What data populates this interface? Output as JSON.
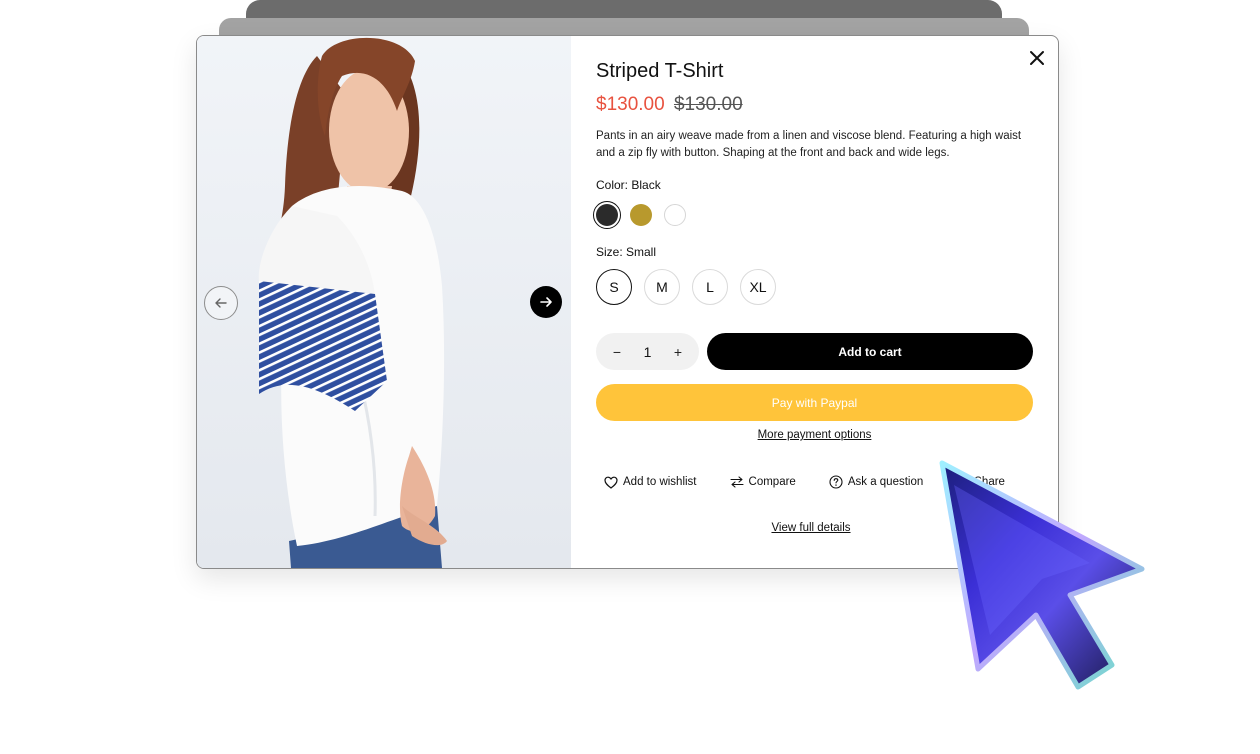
{
  "product": {
    "title": "Striped T-Shirt",
    "price_sale": "$130.00",
    "price_original": "$130.00",
    "description": "Pants in an airy weave made from a linen and viscose blend. Featuring a high waist and a zip fly with button. Shaping at the front and back and wide legs.",
    "color_label": "Color: Black",
    "colors": [
      {
        "name": "Black",
        "hex": "#2b2b2b",
        "selected": true
      },
      {
        "name": "Mustard",
        "hex": "#b8992d",
        "selected": false
      },
      {
        "name": "White",
        "hex": "#ffffff",
        "selected": false
      }
    ],
    "size_label": "Size: Small",
    "sizes": [
      "S",
      "M",
      "L",
      "XL"
    ],
    "selected_size": "S",
    "quantity": "1"
  },
  "buttons": {
    "qty_minus": "−",
    "qty_plus": "+",
    "add_to_cart": "Add to cart",
    "paypal": "Pay with Paypal",
    "more_payment": "More payment options",
    "view_full_details": "View full details"
  },
  "actions": [
    {
      "label": "Add to wishlist",
      "icon": "heart-icon"
    },
    {
      "label": "Compare",
      "icon": "compare-arrows-icon"
    },
    {
      "label": "Ask a question",
      "icon": "question-circle-icon"
    },
    {
      "label": "Share",
      "icon": "share-icon"
    }
  ],
  "colors": {
    "sale_price": "#e8523f",
    "paypal_bg": "#ffc43a",
    "cart_bg": "#000000"
  }
}
